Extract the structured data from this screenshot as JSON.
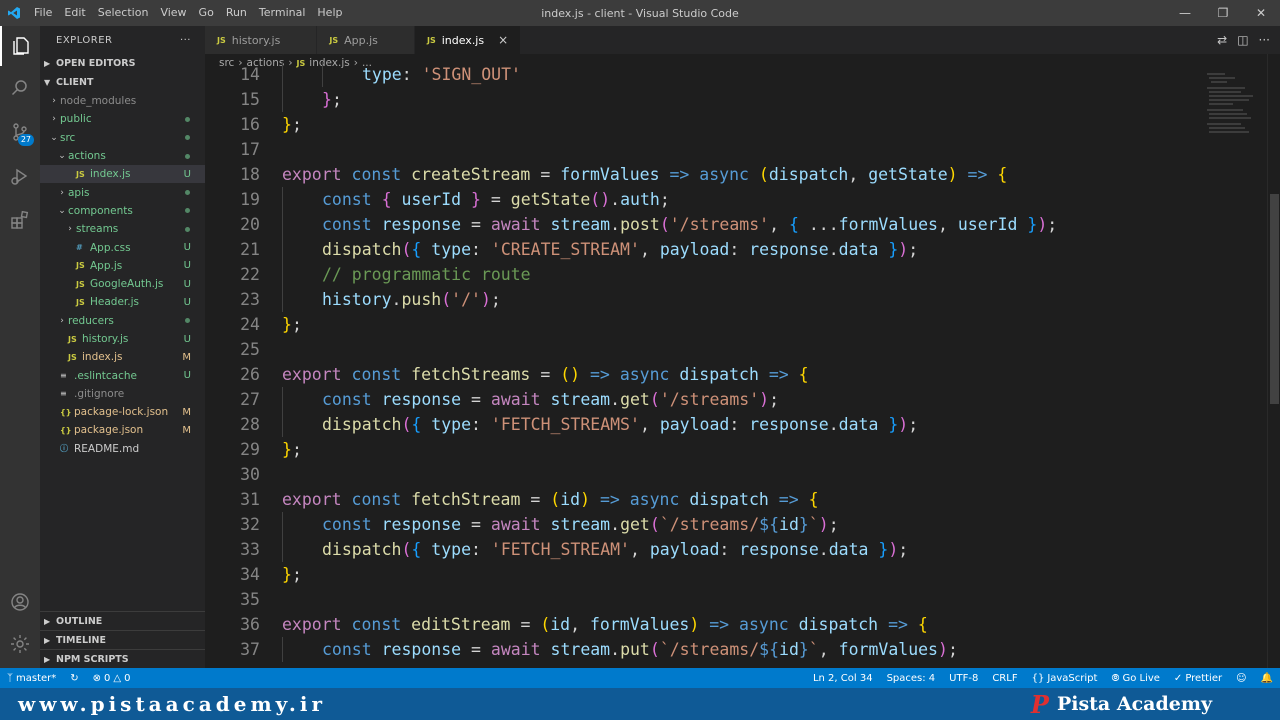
{
  "titlebar": {
    "menu": [
      "File",
      "Edit",
      "Selection",
      "View",
      "Go",
      "Run",
      "Terminal",
      "Help"
    ],
    "title": "index.js - client - Visual Studio Code"
  },
  "activity": {
    "source_control_badge": "27"
  },
  "sidebar": {
    "header": "EXPLORER",
    "open_editors": "OPEN EDITORS",
    "root": "CLIENT",
    "tree": [
      {
        "label": "node_modules",
        "kind": "folder",
        "status": ""
      },
      {
        "label": "public",
        "kind": "folder",
        "status": "dot"
      },
      {
        "label": "src",
        "kind": "folder-open",
        "status": "dot"
      },
      {
        "label": "actions",
        "kind": "folder-open",
        "status": "dot"
      },
      {
        "label": "index.js",
        "kind": "js",
        "status": "U"
      },
      {
        "label": "apis",
        "kind": "folder",
        "status": "dot"
      },
      {
        "label": "components",
        "kind": "folder-open",
        "status": "dot"
      },
      {
        "label": "streams",
        "kind": "folder",
        "status": "dot"
      },
      {
        "label": "App.css",
        "kind": "css",
        "status": "U"
      },
      {
        "label": "App.js",
        "kind": "js",
        "status": "U"
      },
      {
        "label": "GoogleAuth.js",
        "kind": "js",
        "status": "U"
      },
      {
        "label": "Header.js",
        "kind": "js",
        "status": "U"
      },
      {
        "label": "reducers",
        "kind": "folder",
        "status": "dot"
      },
      {
        "label": "history.js",
        "kind": "js",
        "status": "U"
      },
      {
        "label": "index.js",
        "kind": "js",
        "status": "M"
      },
      {
        "label": ".eslintcache",
        "kind": "doc",
        "status": "U"
      },
      {
        "label": ".gitignore",
        "kind": "doc",
        "status": ""
      },
      {
        "label": "package-lock.json",
        "kind": "json",
        "status": "M"
      },
      {
        "label": "package.json",
        "kind": "json",
        "status": "M"
      },
      {
        "label": "README.md",
        "kind": "md",
        "status": ""
      }
    ],
    "outline": "OUTLINE",
    "timeline": "TIMELINE",
    "npm_scripts": "NPM SCRIPTS"
  },
  "tabs": [
    {
      "label": "history.js",
      "active": false
    },
    {
      "label": "App.js",
      "active": false
    },
    {
      "label": "index.js",
      "active": true
    }
  ],
  "breadcrumb": [
    "src",
    "actions",
    "index.js",
    "..."
  ],
  "status": {
    "branch": "master*",
    "problems": "0",
    "warnings": "0",
    "position": "Ln 2, Col 34",
    "spaces": "Spaces: 4",
    "encoding": "UTF-8",
    "eol": "CRLF",
    "language": "JavaScript",
    "golive": "Go Live",
    "prettier": "Prettier"
  },
  "footer": {
    "url": "www.pistaacademy.ir",
    "brand": "Pista Academy"
  }
}
